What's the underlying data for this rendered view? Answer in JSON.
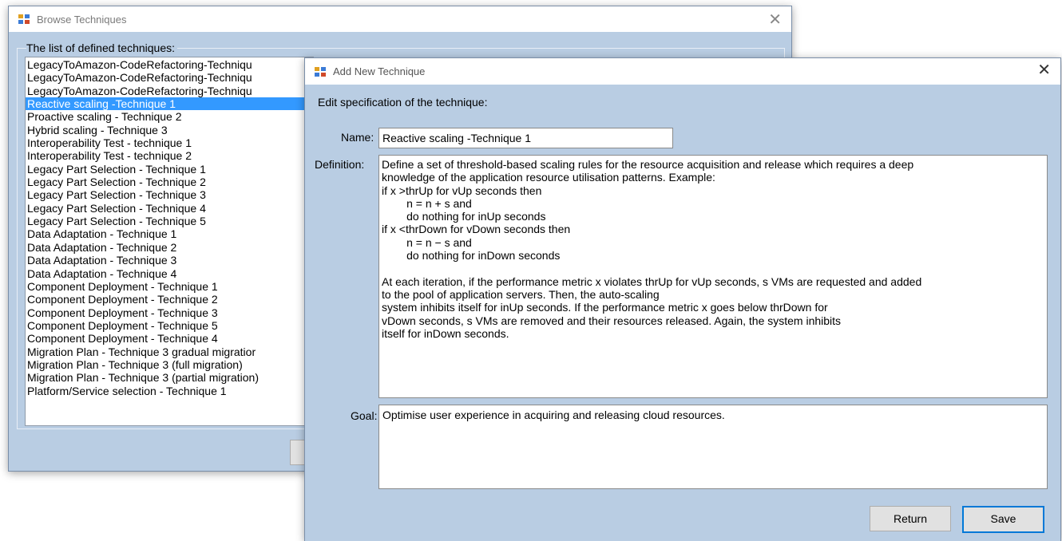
{
  "browse_window": {
    "title": "Browse Techniques",
    "list_label": "The list of defined techniques:",
    "selected_index": 3,
    "items": [
      "LegacyToAmazon-CodeRefactoring-Techniqu",
      "LegacyToAmazon-CodeRefactoring-Techniqu",
      "LegacyToAmazon-CodeRefactoring-Techniqu",
      "Reactive scaling -Technique 1",
      "Proactive scaling - Technique 2",
      "Hybrid scaling - Technique 3",
      "Interoperability Test - technique 1",
      "Interoperability Test - technique 2",
      "Legacy Part Selection - Technique 1",
      "Legacy Part Selection - Technique 2",
      "Legacy Part Selection - Technique 3",
      "Legacy Part Selection - Technique 4",
      "Legacy Part Selection - Technique 5",
      "Data Adaptation - Technique 1",
      "Data Adaptation - Technique 2",
      "Data Adaptation - Technique 3",
      "Data Adaptation - Technique 4",
      "Component Deployment - Technique 1",
      "Component Deployment - Technique 2",
      "Component Deployment - Technique 3",
      "Component Deployment - Technique 5",
      "Component Deployment - Technique 4",
      "Migration Plan - Technique 3 gradual migratior",
      "Migration Plan - Technique 3 (full migration)",
      "Migration Plan - Technique 3 (partial migration)",
      "Platform/Service selection - Technique 1"
    ]
  },
  "add_window": {
    "title": "Add New Technique",
    "heading": "Edit specification of the technique:",
    "name_label": "Name:",
    "name_value": "Reactive scaling -Technique 1",
    "definition_label": "Definition:",
    "definition_value": "Define a set of threshold-based scaling rules for the resource acquisition and release which requires a deep\nknowledge of the application resource utilisation patterns. Example:\nif x >thrUp for vUp seconds then\n        n = n + s and\n        do nothing for inUp seconds\nif x <thrDown for vDown seconds then\n        n = n − s and\n        do nothing for inDown seconds\n\nAt each iteration, if the performance metric x violates thrUp for vUp seconds, s VMs are requested and added\nto the pool of application servers. Then, the auto-scaling\nsystem inhibits itself for inUp seconds. If the performance metric x goes below thrDown for\nvDown seconds, s VMs are removed and their resources released. Again, the system inhibits\nitself for inDown seconds.",
    "goal_label": "Goal:",
    "goal_value": "Optimise user experience in acquiring and releasing cloud resources.",
    "return_label": "Return",
    "save_label": "Save"
  },
  "colors": {
    "window_bg": "#b9cde3",
    "selection": "#3399ff",
    "accent_border": "#0078d7"
  }
}
